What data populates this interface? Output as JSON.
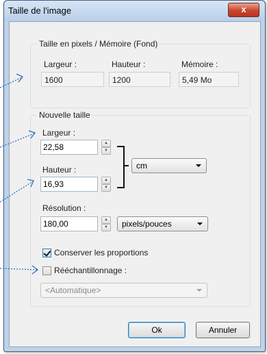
{
  "window": {
    "title": "Taille de l'image",
    "close_glyph": "x"
  },
  "pixel_size_group": {
    "title": "Taille en pixels / Mémoire (Fond)",
    "width_label": "Largeur :",
    "width_value": "1600",
    "height_label": "Hauteur :",
    "height_value": "1200",
    "memory_label": "Mémoire :",
    "memory_value": "5,49 Mo"
  },
  "new_size_group": {
    "title": "Nouvelle taille",
    "width_label": "Largeur :",
    "width_value": "22,58",
    "height_label": "Hauteur :",
    "height_value": "16,93",
    "unit_select": "cm",
    "resolution_label": "Résolution :",
    "resolution_value": "180,00",
    "resolution_unit_select": "pixels/pouces",
    "keep_proportions_label": "Conserver les proportions",
    "keep_proportions_checked": true,
    "resample_label": "Rééchantillonnage :",
    "resample_checked": false,
    "resample_method_select": "<Automatique>"
  },
  "buttons": {
    "ok_label": "Ok",
    "cancel_label": "Annuler"
  },
  "icons": {
    "spin_up": "spin-up-icon",
    "spin_down": "spin-down-icon",
    "dropdown": "chevron-down-icon",
    "checkmark": "checkmark-icon"
  },
  "colors": {
    "annotation_arrow": "#2f6fbf",
    "titlebar": "#c7d9ee",
    "close_button": "#c9452d"
  }
}
